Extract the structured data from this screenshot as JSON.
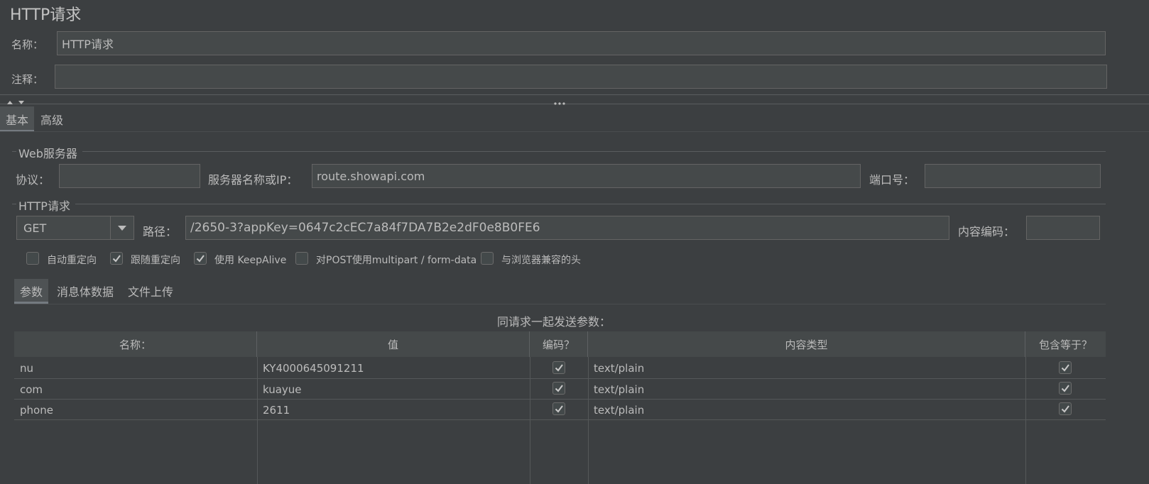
{
  "title": "HTTP请求",
  "name_label": "名称：",
  "name_value": "HTTP请求",
  "comment_label": "注释：",
  "comment_value": "",
  "tabs": [
    {
      "label": "基本"
    },
    {
      "label": "高级"
    }
  ],
  "web_server": {
    "legend": "Web服务器",
    "protocol_label": "协议：",
    "protocol_value": "",
    "server_label": "服务器名称或IP：",
    "server_value": "route.showapi.com",
    "port_label": "端口号：",
    "port_value": ""
  },
  "http_request": {
    "legend": "HTTP请求",
    "method": "GET",
    "path_label": "路径：",
    "path_value": "/2650-3?appKey=0647c2cEC7a84f7DA7B2e2dF0e8B0FE6",
    "encoding_label": "内容编码：",
    "encoding_value": "",
    "options": [
      {
        "label": "自动重定向",
        "checked": false
      },
      {
        "label": "跟随重定向",
        "checked": true
      },
      {
        "label": "使用 KeepAlive",
        "checked": true
      },
      {
        "label": "对POST使用multipart / form-data",
        "checked": false
      },
      {
        "label": "与浏览器兼容的头",
        "checked": false
      }
    ]
  },
  "sub_tabs": [
    {
      "label": "参数"
    },
    {
      "label": "消息体数据"
    },
    {
      "label": "文件上传"
    }
  ],
  "params": {
    "caption": "同请求一起发送参数：",
    "columns": [
      "名称：",
      "值",
      "编码？",
      "内容类型",
      "包含等于？"
    ],
    "rows": [
      {
        "name": "nu",
        "value": "KY4000645091211",
        "encode": true,
        "content_type": "text/plain",
        "include_equals": true
      },
      {
        "name": "com",
        "value": "kuayue",
        "encode": true,
        "content_type": "text/plain",
        "include_equals": true
      },
      {
        "name": "phone",
        "value": "2611",
        "encode": true,
        "content_type": "text/plain",
        "include_equals": true
      }
    ]
  }
}
